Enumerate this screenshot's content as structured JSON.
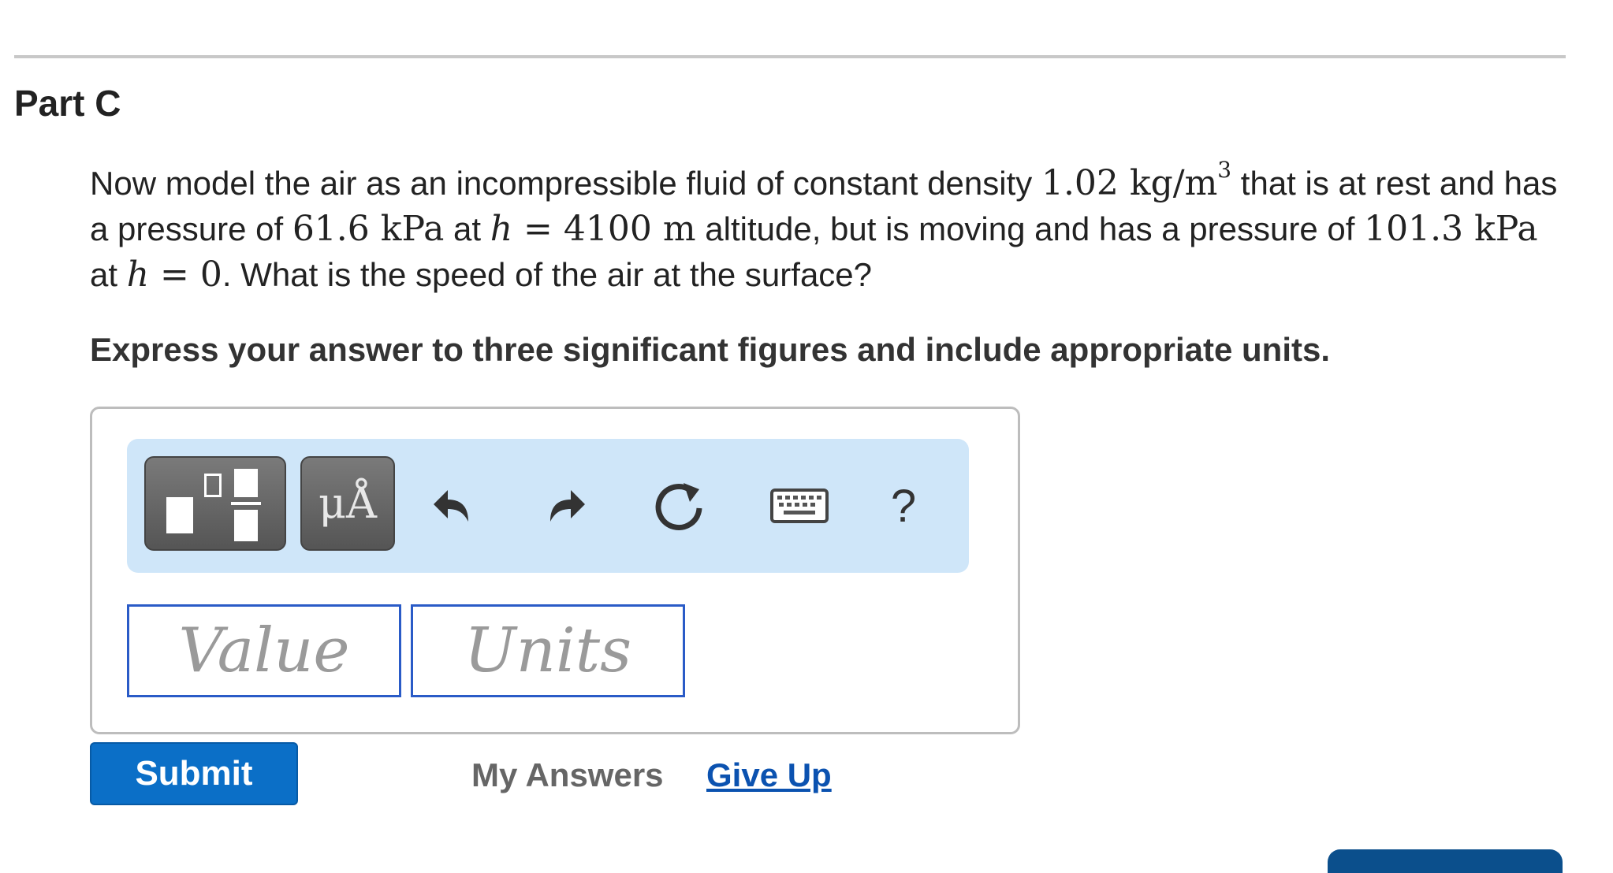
{
  "part": {
    "title": "Part C"
  },
  "question": {
    "t1": "Now model the air as an incompressible fluid of constant density ",
    "density": "1.02",
    "density_unit": "kg/m",
    "density_exp": "3",
    "t2": " that is at rest and has a pressure of ",
    "p1": "61.6",
    "p1_unit": "kPa",
    "t3": " at ",
    "h_var": "h",
    "eq": " = ",
    "h1": "4100",
    "h1_unit": "m",
    "t4": " altitude, but is moving and has a pressure of ",
    "p2": "101.3",
    "p2_unit": "kPa",
    "t5": " at ",
    "h2": "0",
    "t6": ". What is the speed of the air at the surface?"
  },
  "instruction": "Express your answer to three significant figures and include appropriate units.",
  "toolbar": {
    "symbols_label": "μÅ",
    "help_label": "?"
  },
  "inputs": {
    "value_placeholder": "Value",
    "units_placeholder": "Units"
  },
  "actions": {
    "submit": "Submit",
    "my_answers": "My Answers",
    "give_up": "Give Up"
  }
}
